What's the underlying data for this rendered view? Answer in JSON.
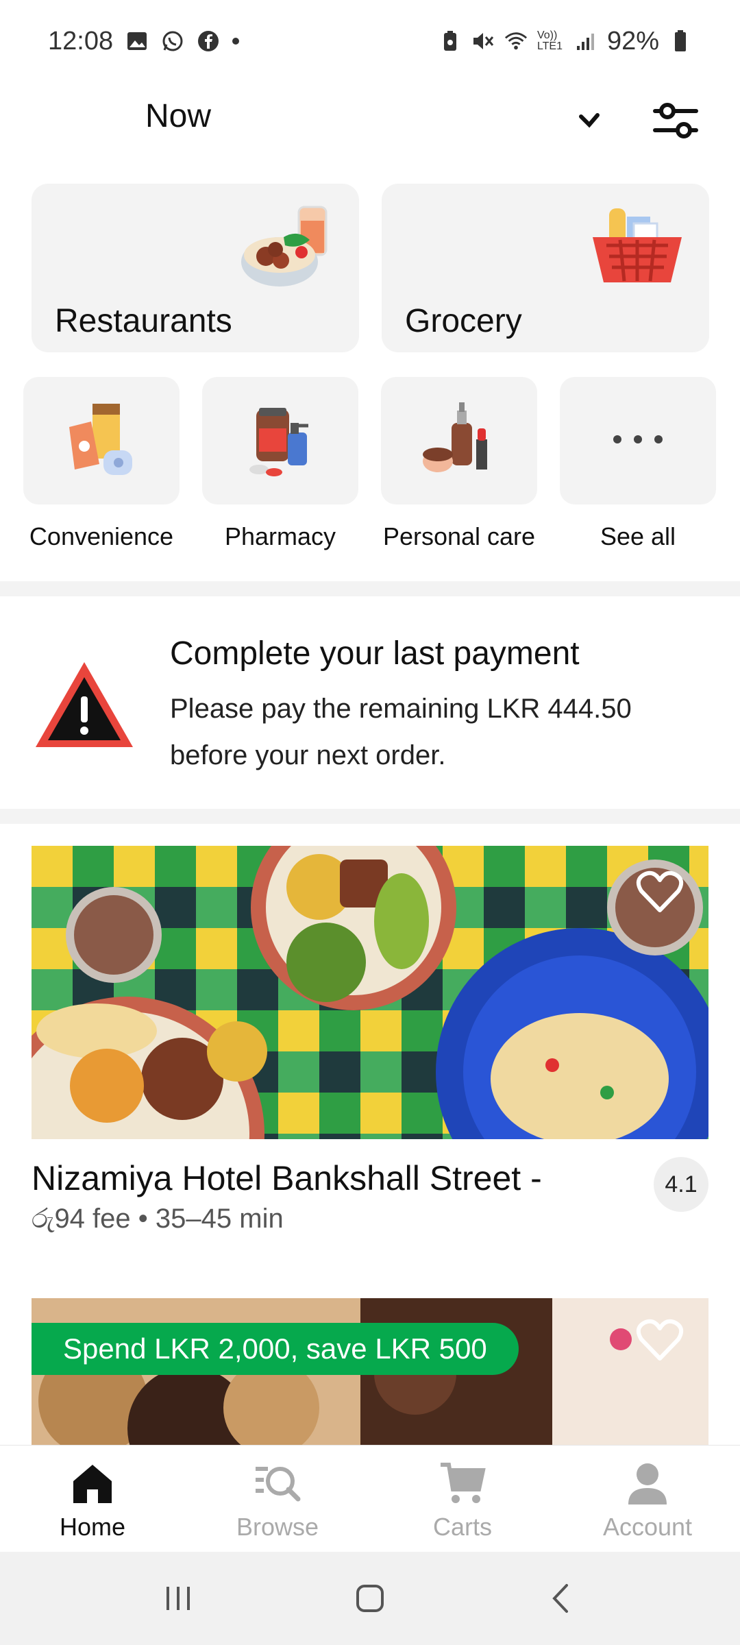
{
  "status_bar": {
    "time": "12:08",
    "battery": "92%",
    "network": "Vo)) LTE1"
  },
  "header": {
    "schedule_label": "Now"
  },
  "categories_big": [
    {
      "label": "Restaurants",
      "icon": "food-bowl-icon"
    },
    {
      "label": "Grocery",
      "icon": "grocery-basket-icon"
    }
  ],
  "categories_small": [
    {
      "label": "Convenience",
      "icon": "convenience-icon"
    },
    {
      "label": "Pharmacy",
      "icon": "pharmacy-icon"
    },
    {
      "label": "Personal care",
      "icon": "personal-care-icon"
    },
    {
      "label": "See all",
      "icon": "more-dots-icon"
    }
  ],
  "payment_banner": {
    "title": "Complete your last payment",
    "body": "Please pay the remaining LKR 444.50 before your next order."
  },
  "restaurants": [
    {
      "name": "Nizamiya Hotel Bankshall Street -",
      "fee": "රු94 fee",
      "eta": "35–45 min",
      "rating": "4.1"
    },
    {
      "promo": "Spend LKR 2,000, save LKR 500"
    }
  ],
  "bottom_nav": [
    {
      "label": "Home",
      "active": true
    },
    {
      "label": "Browse",
      "active": false
    },
    {
      "label": "Carts",
      "active": false
    },
    {
      "label": "Account",
      "active": false
    }
  ],
  "colors": {
    "accent_green": "#06a94d",
    "tile_bg": "#f3f3f3"
  }
}
